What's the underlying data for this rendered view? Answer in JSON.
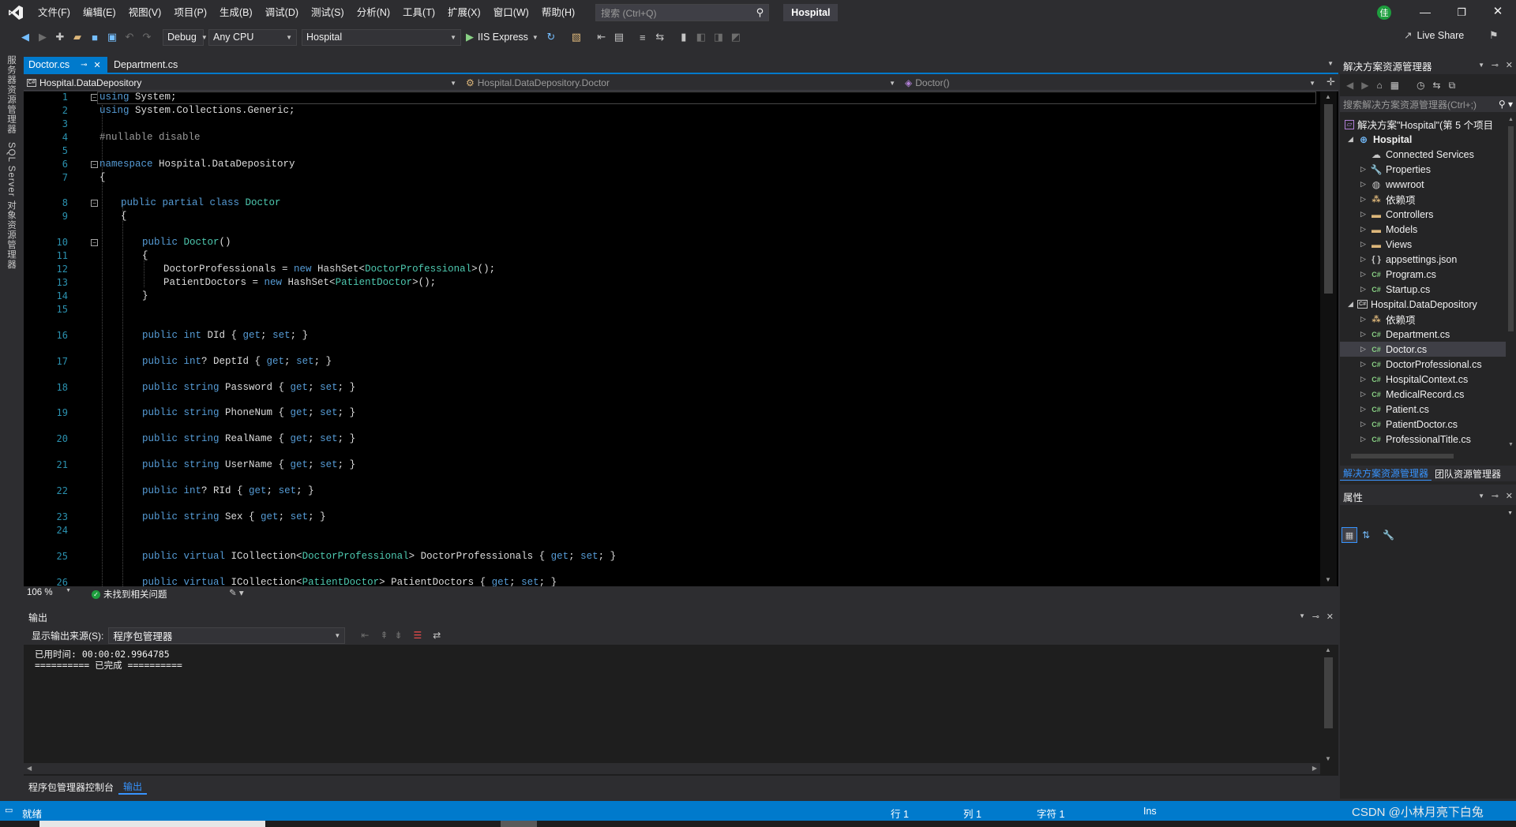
{
  "menubar": {
    "items": [
      "文件(F)",
      "编辑(E)",
      "视图(V)",
      "项目(P)",
      "生成(B)",
      "调试(D)",
      "测试(S)",
      "分析(N)",
      "工具(T)",
      "扩展(X)",
      "窗口(W)",
      "帮助(H)"
    ],
    "search_placeholder": "搜索 (Ctrl+Q)",
    "solution_title": "Hospital",
    "account_initial": "佳"
  },
  "toolbar": {
    "config": "Debug",
    "platform": "Any CPU",
    "startup_project": "Hospital",
    "run_target": "IIS Express",
    "live_share": "Live Share"
  },
  "left_strip": {
    "item1": "服务器资源管理器",
    "item2": "SQL Server 对象资源管理器"
  },
  "tabs": {
    "active": "Doctor.cs",
    "inactive": "Department.cs"
  },
  "navbar": {
    "project": "Hospital.DataDepository",
    "class": "Hospital.DataDepository.Doctor",
    "member": "Doctor()"
  },
  "code": {
    "line_numbers": [
      "1",
      "2",
      "3",
      "4",
      "5",
      "6",
      "7",
      "8",
      "9",
      "10",
      "11",
      "12",
      "13",
      "14",
      "15",
      "16",
      "17",
      "18",
      "19",
      "20",
      "21",
      "22",
      "23",
      "24",
      "25",
      "26"
    ]
  },
  "editor_status": {
    "zoom": "106 %",
    "issues": "未找到相关问题"
  },
  "output": {
    "title": "输出",
    "source_label": "显示输出来源(S):",
    "source_value": "程序包管理器",
    "line1": "已用时间: 00:00:02.9964785",
    "line2": "========== 已完成 =========="
  },
  "bottom_tabs": {
    "pm_console": "程序包管理器控制台",
    "output": "输出"
  },
  "statusbar": {
    "ready": "就绪",
    "row": "行 1",
    "col": "列 1",
    "char": "字符 1",
    "ins": "Ins",
    "watermark": "CSDN @小林月亮下白兔"
  },
  "solution_explorer": {
    "title": "解决方案资源管理器",
    "search_placeholder": "搜索解决方案资源管理器(Ctrl+;)",
    "solution_node": "解决方案\"Hospital\"(第 5 个项目",
    "items": [
      {
        "label": "Hospital",
        "icon": "web-project-icon"
      },
      {
        "label": "Connected Services",
        "icon": "connected-services-icon"
      },
      {
        "label": "Properties",
        "icon": "wrench-icon"
      },
      {
        "label": "wwwroot",
        "icon": "globe-icon"
      },
      {
        "label": "依赖项",
        "icon": "dependencies-icon"
      },
      {
        "label": "Controllers",
        "icon": "folder-icon"
      },
      {
        "label": "Models",
        "icon": "folder-icon"
      },
      {
        "label": "Views",
        "icon": "folder-icon"
      },
      {
        "label": "appsettings.json",
        "icon": "json-icon"
      },
      {
        "label": "Program.cs",
        "icon": "csharp-file-icon"
      },
      {
        "label": "Startup.cs",
        "icon": "csharp-file-icon"
      },
      {
        "label": "Hospital.DataDepository",
        "icon": "library-project-icon"
      },
      {
        "label": "依赖项",
        "icon": "dependencies-icon"
      },
      {
        "label": "Department.cs",
        "icon": "csharp-file-icon"
      },
      {
        "label": "Doctor.cs",
        "icon": "csharp-file-icon"
      },
      {
        "label": "DoctorProfessional.cs",
        "icon": "csharp-file-icon"
      },
      {
        "label": "HospitalContext.cs",
        "icon": "csharp-file-icon"
      },
      {
        "label": "MedicalRecord.cs",
        "icon": "csharp-file-icon"
      },
      {
        "label": "Patient.cs",
        "icon": "csharp-file-icon"
      },
      {
        "label": "PatientDoctor.cs",
        "icon": "csharp-file-icon"
      },
      {
        "label": "ProfessionalTitle.cs",
        "icon": "csharp-file-icon"
      }
    ],
    "tab_solution": "解决方案资源管理器",
    "tab_team": "团队资源管理器"
  },
  "properties": {
    "title": "属性"
  },
  "colors": {
    "accent": "#007acc",
    "keyword": "#569cd6",
    "type": "#4ec9b0",
    "line_number": "#2b91af",
    "editor_bg": "#000000",
    "chrome_bg": "#2d2d30"
  }
}
